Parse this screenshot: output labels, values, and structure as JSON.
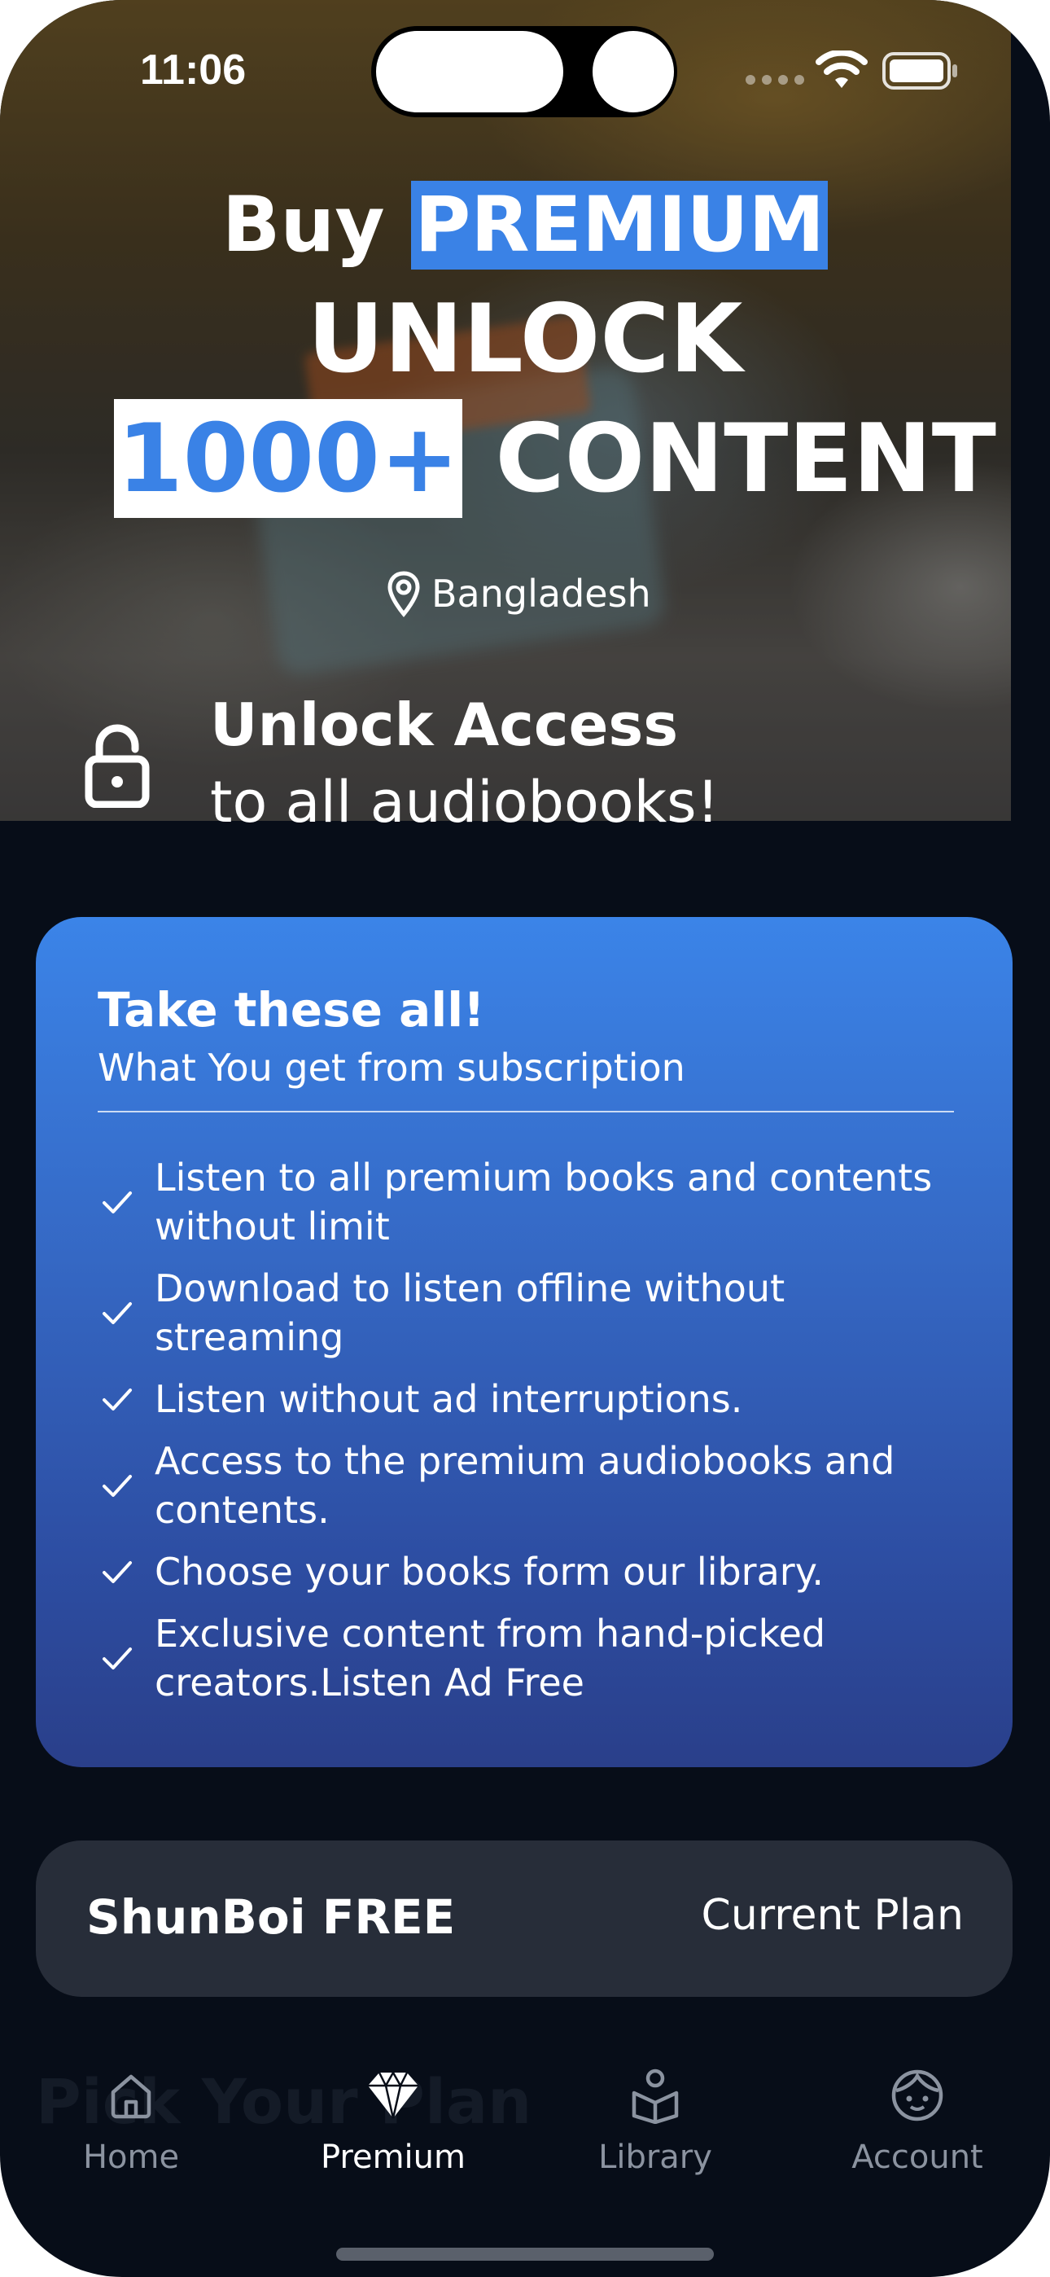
{
  "status_bar": {
    "time": "11:06"
  },
  "hero": {
    "buy_text": "Buy",
    "premium_text": "PREMIUM",
    "unlock_text": "UNLOCK",
    "count_text": "1000+",
    "content_text": "CONTENT",
    "location": "Bangladesh",
    "access_title": "Unlock Access",
    "access_sub": "to all audiobooks!"
  },
  "benefits_card": {
    "title": "Take these all!",
    "subtitle": "What You get from subscription",
    "items": [
      "Listen to all premium books and contents without limit",
      "Download to listen offline without streaming",
      "Listen without ad interruptions.",
      "Access to the premium audiobooks and contents.",
      "Choose your books form our library.",
      "Exclusive content from hand-picked creators.Listen Ad Free"
    ]
  },
  "plan": {
    "name": "ShunBoi FREE",
    "status": "Current Plan"
  },
  "ghost_heading": "Pick Your Plan",
  "tabs": [
    {
      "label": "Home",
      "icon": "home-icon",
      "active": false
    },
    {
      "label": "Premium",
      "icon": "diamond-icon",
      "active": true
    },
    {
      "label": "Library",
      "icon": "library-icon",
      "active": false
    },
    {
      "label": "Account",
      "icon": "account-icon",
      "active": false
    }
  ],
  "colors": {
    "accent": "#3a82e6",
    "background": "#070d18",
    "card_top": "#3b84e8",
    "card_bottom": "#2a3f8a",
    "plan_bg": "#272d39"
  }
}
